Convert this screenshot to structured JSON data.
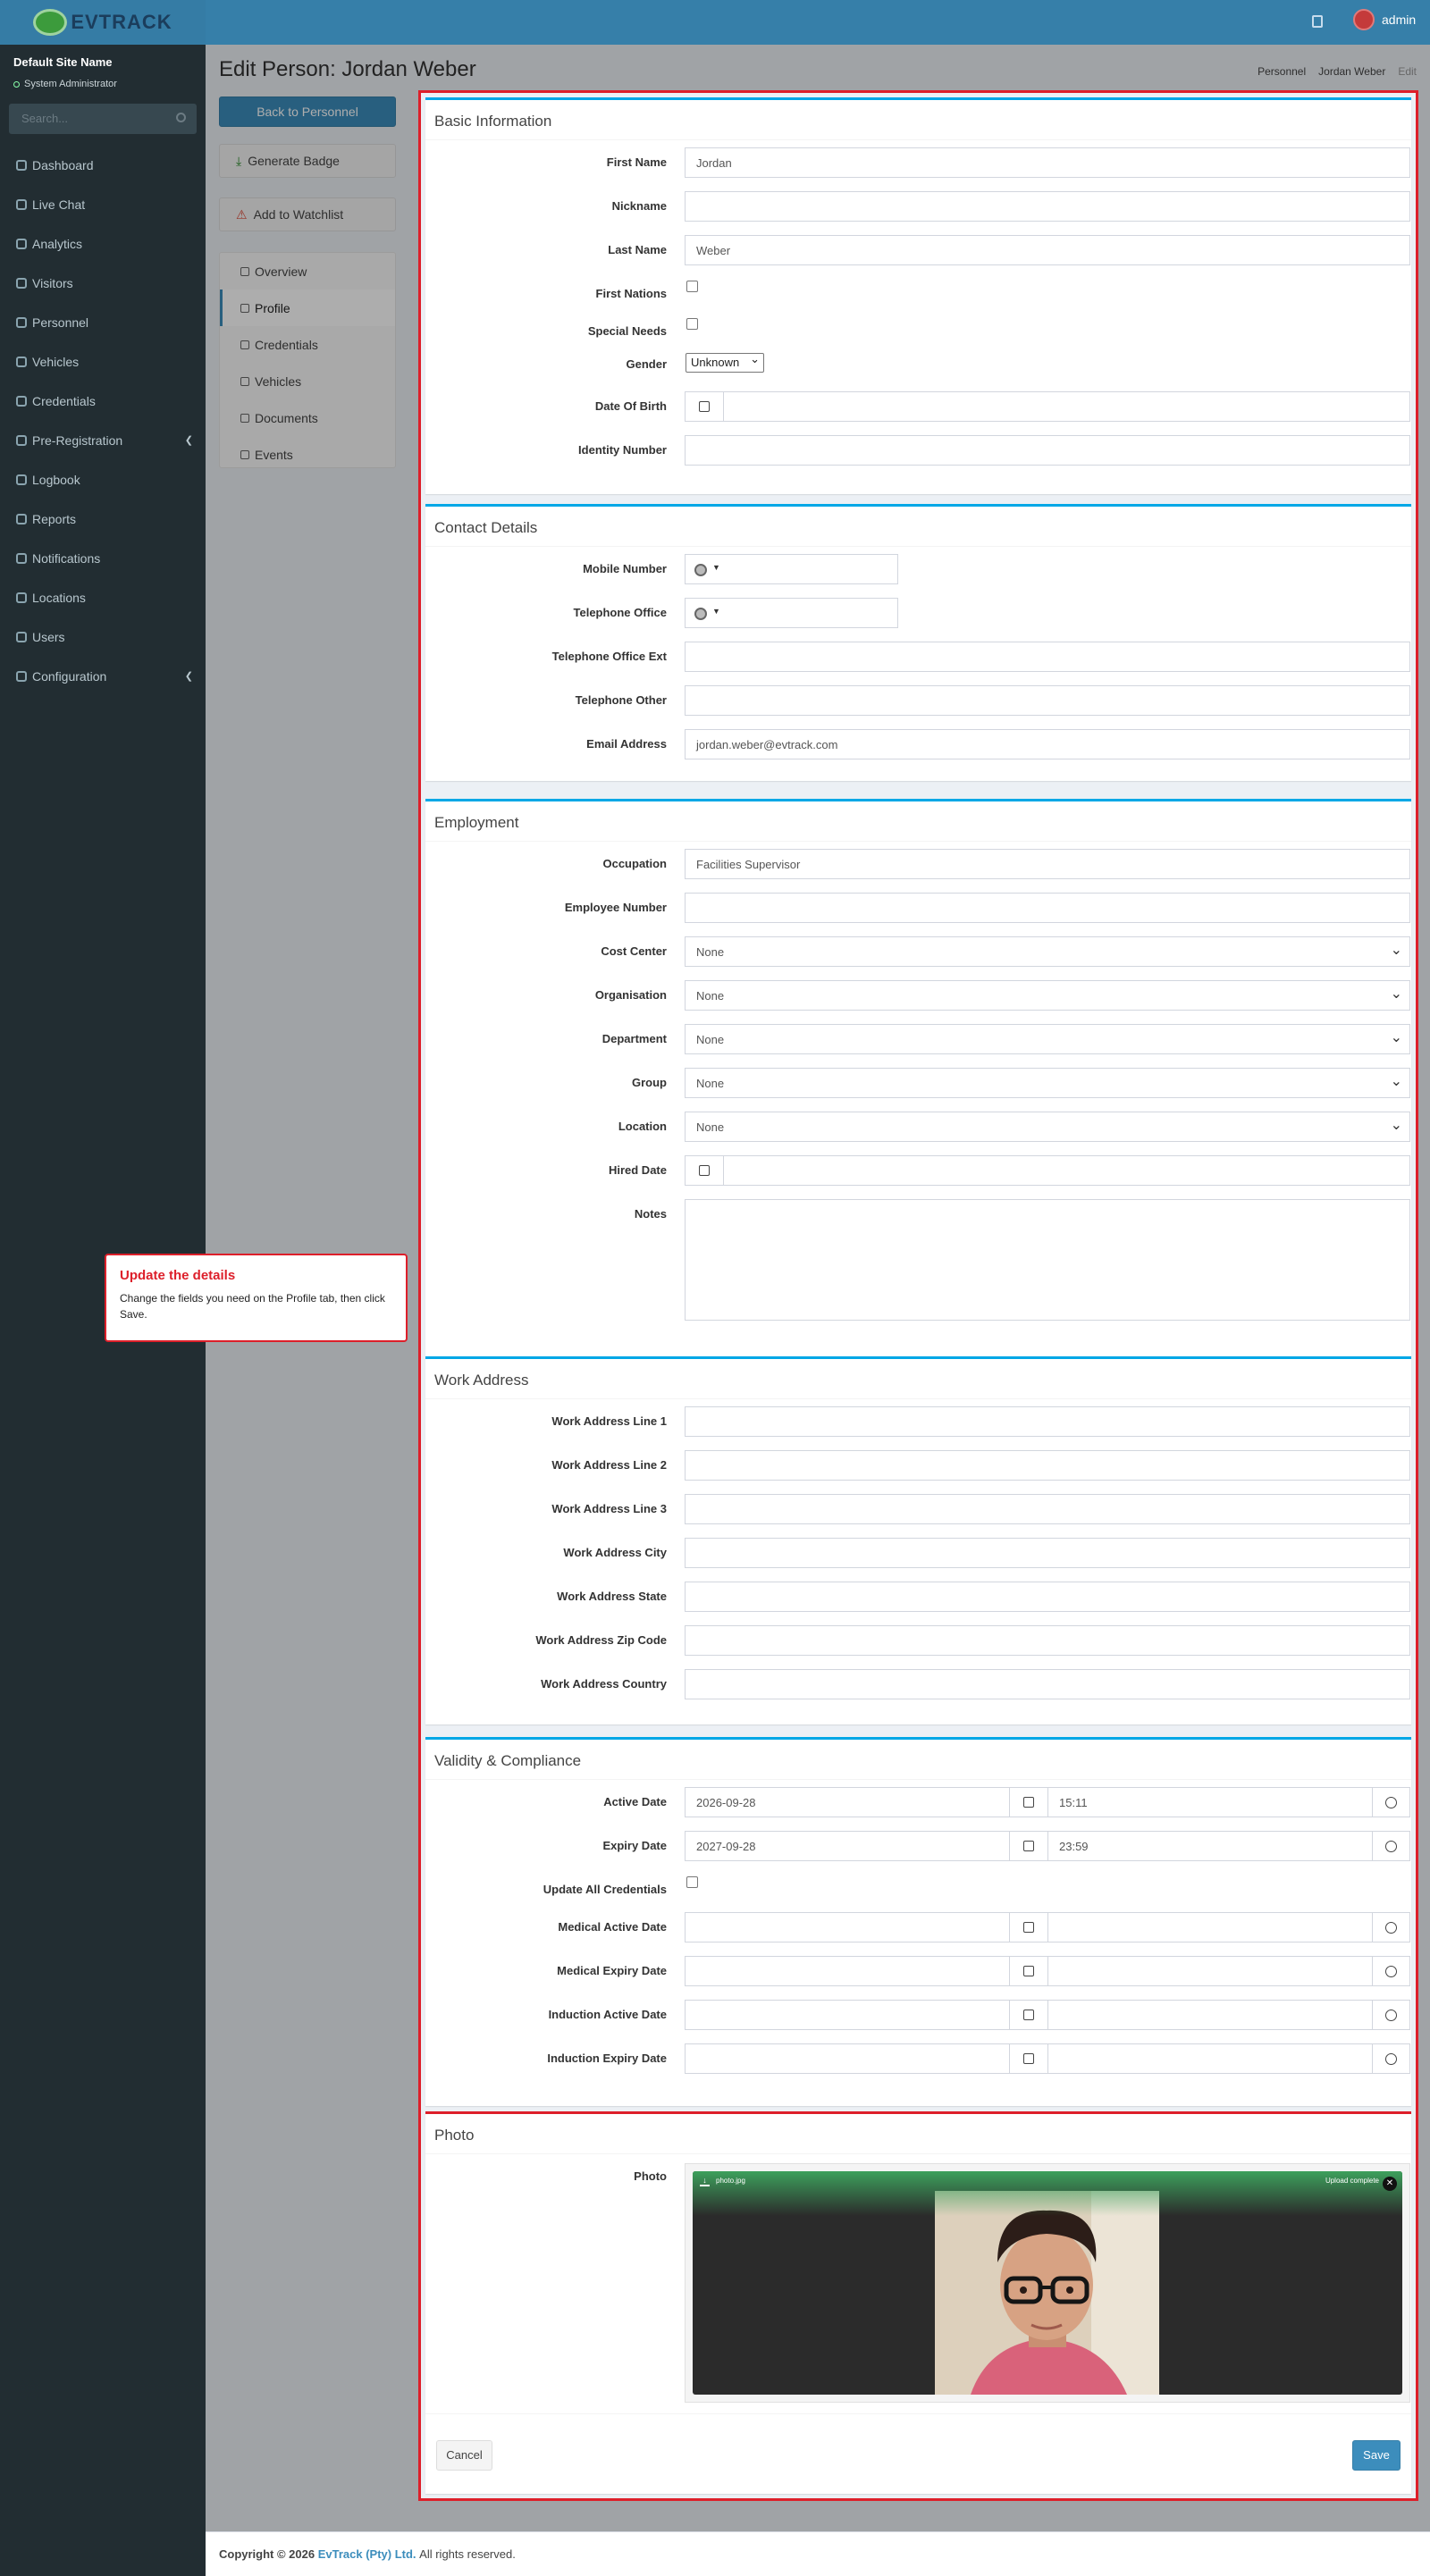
{
  "brand": {
    "name": "EVTRACK",
    "accent": "#3c8dbc",
    "highlight": "#dd1f2a"
  },
  "topbar": {
    "user": "admin",
    "icons": [
      "bell-icon",
      "user-avatar-icon"
    ]
  },
  "sidebar": {
    "site": "Default Site Name",
    "role": "System Administrator",
    "search_placeholder": "Search...",
    "items": [
      {
        "label": "Dashboard",
        "icon": "dashboard-icon"
      },
      {
        "label": "Live Chat",
        "icon": "headset-icon"
      },
      {
        "label": "Analytics",
        "icon": "analytics-icon"
      },
      {
        "label": "Visitors",
        "icon": "eye-icon"
      },
      {
        "label": "Personnel",
        "icon": "personnel-icon"
      },
      {
        "label": "Vehicles",
        "icon": "car-icon"
      },
      {
        "label": "Credentials",
        "icon": "credentials-icon"
      },
      {
        "label": "Pre-Registration",
        "icon": "arrows-icon"
      },
      {
        "label": "Logbook",
        "icon": "book-icon"
      },
      {
        "label": "Reports",
        "icon": "reports-icon"
      },
      {
        "label": "Notifications",
        "icon": "bell-icon"
      },
      {
        "label": "Locations",
        "icon": "building-icon"
      },
      {
        "label": "Users",
        "icon": "users-icon"
      },
      {
        "label": "Configuration",
        "icon": "gear-icon"
      }
    ]
  },
  "page": {
    "title": "Edit Person: Jordan Weber",
    "breadcrumb": [
      "Personnel",
      "Jordan Weber",
      "Edit"
    ],
    "back_button": "Back to Personnel",
    "generate_badge": "Generate Badge",
    "add_watchlist": "Add to Watchlist",
    "nav": [
      "Overview",
      "Profile",
      "Credentials",
      "Vehicles",
      "Documents",
      "Events"
    ],
    "active_nav": "Profile"
  },
  "basic": {
    "title": "Basic Information",
    "first_name_label": "First Name",
    "first_name": "Jordan",
    "nickname_label": "Nickname",
    "nickname": "",
    "last_name_label": "Last Name",
    "last_name": "Weber",
    "first_nations_label": "First Nations",
    "first_nations": false,
    "special_needs_label": "Special Needs",
    "special_needs": false,
    "gender_label": "Gender",
    "gender": "Unknown",
    "dob_label": "Date Of Birth",
    "dob": "",
    "identity_label": "Identity Number",
    "identity": ""
  },
  "contact": {
    "title": "Contact Details",
    "mobile_label": "Mobile Number",
    "tel_office_label": "Telephone Office",
    "tel_ext_label": "Telephone Office Ext",
    "tel_other_label": "Telephone Other",
    "email_label": "Email Address",
    "email": "jordan.weber@evtrack.com"
  },
  "employment": {
    "title": "Employment",
    "occupation_label": "Occupation",
    "occupation": "Facilities Supervisor",
    "employee_number_label": "Employee Number",
    "employee_number": "",
    "cost_center_label": "Cost Center",
    "cost_center": "None",
    "organisation_label": "Organisation",
    "organisation": "None",
    "department_label": "Department",
    "department": "None",
    "group_label": "Group",
    "group": "None",
    "location_label": "Location",
    "location": "None",
    "hired_label": "Hired Date",
    "notes_label": "Notes"
  },
  "work_address": {
    "title": "Work Address",
    "labels": [
      "Work Address Line 1",
      "Work Address Line 2",
      "Work Address Line 3",
      "Work Address City",
      "Work Address State",
      "Work Address Zip Code",
      "Work Address Country"
    ]
  },
  "validity": {
    "title": "Validity & Compliance",
    "active_label": "Active Date",
    "active_date": "2026-09-28",
    "active_time": "15:11",
    "expiry_label": "Expiry Date",
    "expiry_date": "2027-09-28",
    "expiry_time": "23:59",
    "update_all_label": "Update All Credentials",
    "medical_active_label": "Medical Active Date",
    "medical_expiry_label": "Medical Expiry Date",
    "induction_active_label": "Induction Active Date",
    "induction_expiry_label": "Induction Expiry Date"
  },
  "photo": {
    "title": "Photo",
    "label": "Photo",
    "filename": "photo.jpg",
    "status": "Upload complete"
  },
  "actions": {
    "cancel": "Cancel",
    "save": "Save"
  },
  "tooltip": {
    "title": "Update the details",
    "body": "Change the fields you need on the Profile tab, then click Save."
  },
  "footer": {
    "copyright": "Copyright © 2026",
    "company": "EvTrack (Pty) Ltd.",
    "rights": "All rights reserved."
  }
}
